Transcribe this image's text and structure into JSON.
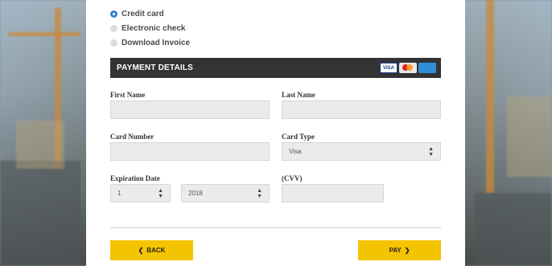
{
  "payment_methods": [
    {
      "label": "Credit card",
      "selected": true
    },
    {
      "label": "Electronic check",
      "selected": false
    },
    {
      "label": "Download Invoice",
      "selected": false
    }
  ],
  "section": {
    "title": "PAYMENT DETAILS",
    "card_logos": [
      "VISA",
      "mastercard",
      "amex"
    ]
  },
  "form": {
    "first_name_label": "First Name",
    "last_name_label": "Last Name",
    "card_number_label": "Card Number",
    "card_type_label": "Card Type",
    "card_type_value": "Visa",
    "expiration_label": "Expiration Date",
    "exp_month_value": "1",
    "exp_year_value": "2018",
    "cvv_label": "(CVV)"
  },
  "buttons": {
    "back_label": "BACK",
    "pay_label": "PAY"
  },
  "colors": {
    "accent": "#f5c400",
    "header": "#333333",
    "radio_selected": "#2f7fd0"
  }
}
